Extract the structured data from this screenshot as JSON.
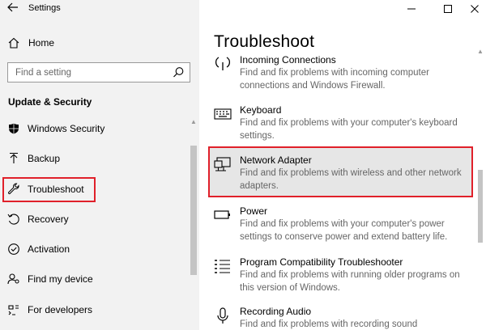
{
  "window": {
    "app_title": "Settings"
  },
  "sidebar": {
    "home_label": "Home",
    "search_placeholder": "Find a setting",
    "section_title": "Update & Security",
    "items": [
      {
        "label": "Windows Security",
        "icon": "shield-icon"
      },
      {
        "label": "Backup",
        "icon": "backup-arrow-icon"
      },
      {
        "label": "Troubleshoot",
        "icon": "wrench-icon",
        "selected": true
      },
      {
        "label": "Recovery",
        "icon": "recovery-icon"
      },
      {
        "label": "Activation",
        "icon": "activation-check-icon"
      },
      {
        "label": "Find my device",
        "icon": "person-location-icon"
      },
      {
        "label": "For developers",
        "icon": "developer-tools-icon"
      }
    ]
  },
  "main": {
    "page_title": "Troubleshoot",
    "troubleshooters": [
      {
        "name": "Incoming Connections",
        "description": "Find and fix problems with incoming computer connections and Windows Firewall.",
        "icon": "wifi-signal-icon"
      },
      {
        "name": "Keyboard",
        "description": "Find and fix problems with your computer's keyboard settings.",
        "icon": "keyboard-icon"
      },
      {
        "name": "Network Adapter",
        "description": "Find and fix problems with wireless and other network adapters.",
        "icon": "network-adapter-icon",
        "highlighted": true
      },
      {
        "name": "Power",
        "description": "Find and fix problems with your computer's power settings to conserve power and extend battery life.",
        "icon": "battery-icon"
      },
      {
        "name": "Program Compatibility Troubleshooter",
        "description": "Find and fix problems with running older programs on this version of Windows.",
        "icon": "list-icon"
      },
      {
        "name": "Recording Audio",
        "description": "Find and fix problems with recording sound",
        "icon": "microphone-icon"
      }
    ]
  },
  "colors": {
    "highlight_border": "#e0202a",
    "sidebar_bg": "#f2f2f2",
    "selected_bg": "#e6e6e6",
    "description_text": "#666666"
  }
}
